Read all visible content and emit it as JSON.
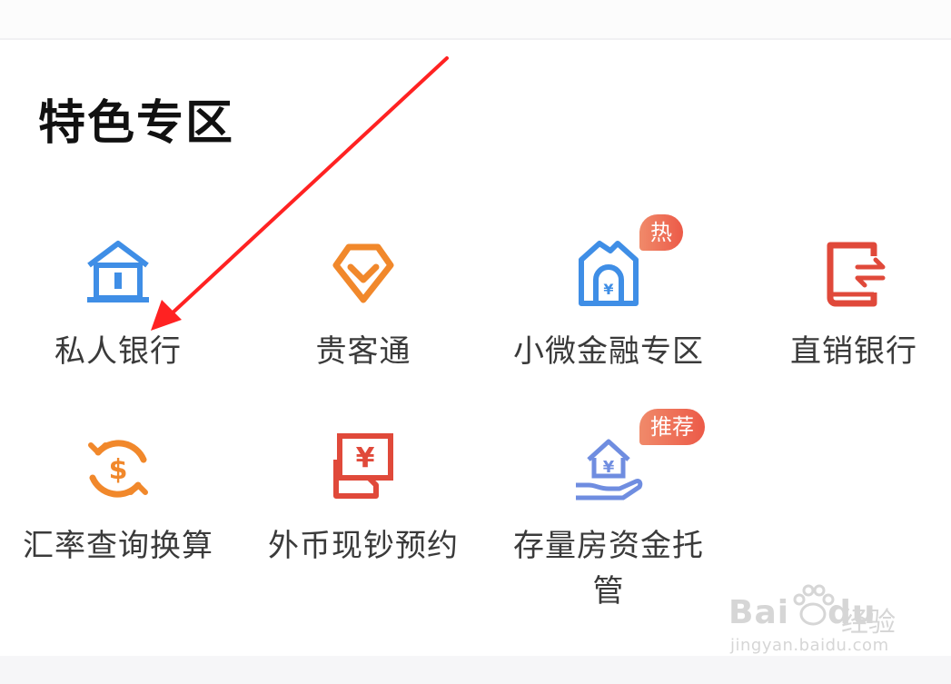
{
  "section": {
    "title": "特色专区"
  },
  "tiles": [
    {
      "label": "私人银行",
      "icon": "bank-building-icon"
    },
    {
      "label": "贵客通",
      "icon": "diamond-icon"
    },
    {
      "label": "小微金融专区",
      "icon": "shop-yuan-icon",
      "badge": "热"
    },
    {
      "label": "直销银行",
      "icon": "transfer-card-icon"
    },
    {
      "label": "汇率查询换算",
      "icon": "currency-exchange-icon"
    },
    {
      "label": "外币现钞预约",
      "icon": "cash-yuan-icon"
    },
    {
      "label": "存量房资金托管",
      "label_line2": "管",
      "icon": "house-hand-icon",
      "badge": "推荐"
    }
  ],
  "watermark": {
    "brand": "Bai",
    "brand2": "du",
    "cn": "经验",
    "url": "jingyan.baidu.com"
  },
  "colors": {
    "blue": "#3f8ee6",
    "orange": "#f1882b",
    "red": "#e0493a",
    "arrow": "#ff2222",
    "badge": "#ec5a48"
  }
}
